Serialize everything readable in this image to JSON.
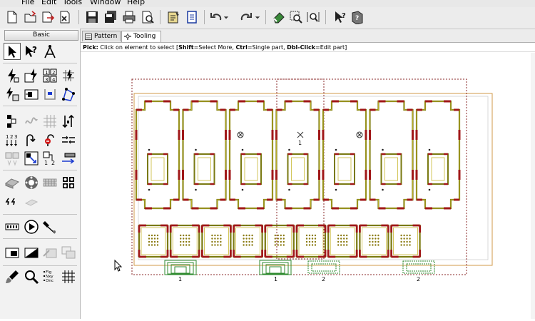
{
  "menu": [
    "File",
    "Edit",
    "Tools",
    "Window",
    "Help"
  ],
  "palette": {
    "tab_label": "Basic"
  },
  "tabs": [
    {
      "label": "Pattern",
      "active": false
    },
    {
      "label": "Tooling",
      "active": true
    }
  ],
  "status": {
    "prefix": "Pick:",
    "text": " Click on element to select [",
    "k1": "Shift",
    "t1": "=Select More, ",
    "k2": "Ctrl",
    "t2": "=Single part, ",
    "k3": "Dbl-Click",
    "t3": "=Edit part]"
  },
  "palette_labels": {
    "seq_numbers": [
      "1",
      "2",
      "3",
      "4"
    ],
    "seq_two": [
      "1",
      "2"
    ],
    "flags": [
      "Flg",
      "Nxy",
      "Onc"
    ]
  },
  "canvas_labels": {
    "part_number": "1",
    "bottom_labels": [
      "1",
      "1",
      "2",
      "2"
    ]
  },
  "colors": {
    "part_outline": "#7a7a12",
    "part_outline_inner": "#c8b832",
    "corner_tool": "#a01818",
    "sheet_border": "#d09848",
    "dotted_frame": "#8a2a2a",
    "tool_green": "#2e8a2e",
    "dots": "#8a7a10"
  }
}
